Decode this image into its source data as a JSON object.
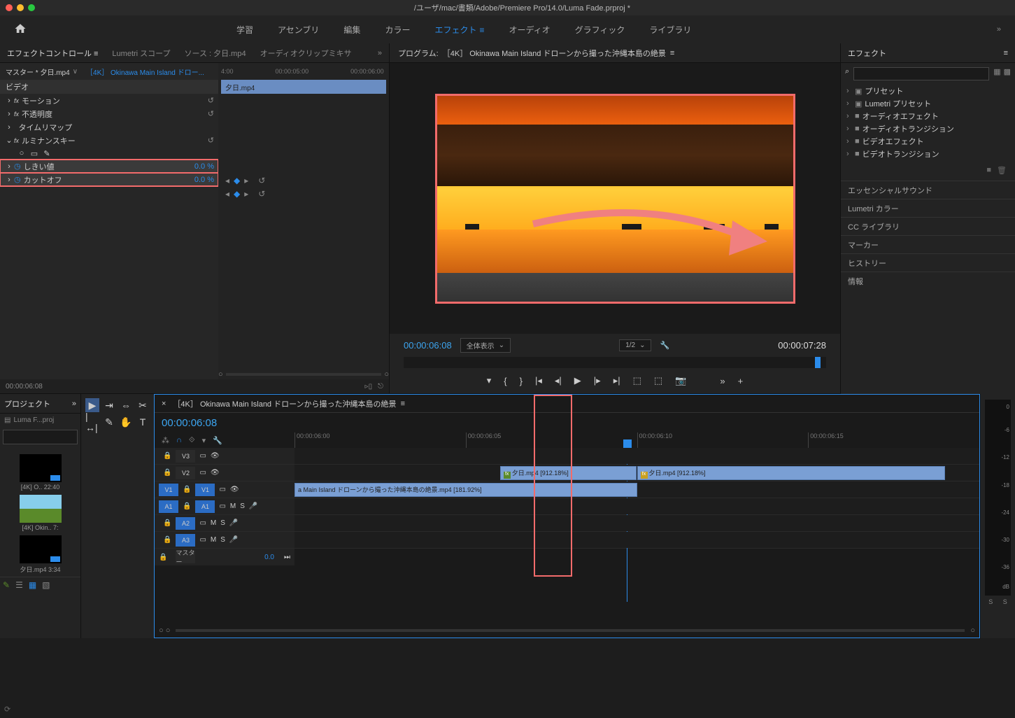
{
  "titlebar": {
    "path": "/ユーザ/mac/書類/Adobe/Premiere Pro/14.0/Luma  Fade.prproj *"
  },
  "workspace": {
    "tabs": [
      "学習",
      "アセンブリ",
      "編集",
      "カラー",
      "エフェクト",
      "オーディオ",
      "グラフィック",
      "ライブラリ"
    ],
    "active_index": 4
  },
  "left_panel_tabs": [
    "エフェクトコントロール",
    "Lumetri スコープ",
    "ソース : 夕日.mp4",
    "オーディオクリップミキサ"
  ],
  "ec": {
    "master": "マスター * 夕日.mp4",
    "clip": "［4K］ Okinawa Main Island ドロー...",
    "section_video": "ビデオ",
    "motion": "モーション",
    "opacity": "不透明度",
    "timeremap": "タイムリマップ",
    "lumakey": "ルミナンスキー",
    "threshold": {
      "label": "しきい値",
      "value": "0.0 %"
    },
    "cutoff": {
      "label": "カットオフ",
      "value": "0.0 %"
    },
    "ruler": [
      "4:00",
      "00:00:05:00",
      "00:00:06:00"
    ],
    "clip_bar": "夕日.mp4",
    "footer_time": "00:00:06:08"
  },
  "program": {
    "label": "プログラム:",
    "title": "［4K］ Okinawa Main Island ドローンから撮った沖縄本島の絶景",
    "timecode": "00:00:06:08",
    "fit": "全体表示",
    "res": "1/2",
    "duration": "00:00:07:28"
  },
  "effects": {
    "title": "エフェクト",
    "search_placeholder": "",
    "folders": [
      "プリセット",
      "Lumetri プリセット",
      "オーディオエフェクト",
      "オーディオトランジション",
      "ビデオエフェクト",
      "ビデオトランジション"
    ],
    "panels": [
      "エッセンシャルサウンド",
      "Lumetri カラー",
      "CC ライブラリ",
      "マーカー",
      "ヒストリー",
      "情報"
    ]
  },
  "project": {
    "title": "プロジェクト",
    "filename": "Luma  F...proj",
    "bins": [
      {
        "label": "[4K]  O..  22:40"
      },
      {
        "label": "[4K]  Okin..  7:"
      },
      {
        "label": "夕日.mp4   3:34"
      }
    ]
  },
  "timeline": {
    "title": "［4K］ Okinawa Main Island ドローンから撮った沖縄本島の絶景",
    "timecode": "00:00:06:08",
    "ruler": [
      "00:00:06:00",
      "00:00:06:05",
      "00:00:06:10",
      "00:00:06:15"
    ],
    "tracks": {
      "v3": "V3",
      "v2": "V2",
      "v1": "V1",
      "a1": "A1",
      "a2": "A2",
      "a3": "A3",
      "master": "マスター",
      "master_val": "0.0"
    },
    "clip_v2_a": "夕日.mp4 [912.18%]",
    "clip_v2_b": "夕日.mp4 [912.18%]",
    "clip_v1": "a Main Island ドローンから撮った沖縄本島の絶景.mp4 [181.92%]"
  },
  "meter": {
    "ticks": [
      "0",
      "-6",
      "-12",
      "-18",
      "-24",
      "-30",
      "-36",
      "--",
      "dB"
    ],
    "solo": "S"
  }
}
